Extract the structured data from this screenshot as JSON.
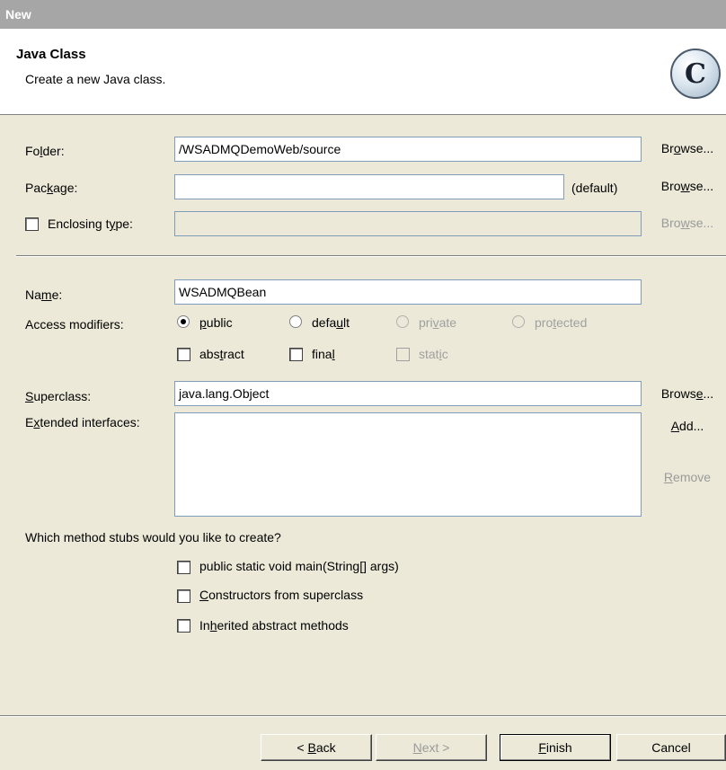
{
  "window": {
    "title": "New"
  },
  "header": {
    "title": "Java Class",
    "description": "Create a new Java class.",
    "icon_letter": "C",
    "icon": "java-class-icon"
  },
  "form": {
    "folder": {
      "label": "Folder:",
      "value": "/WSADMQDemoWeb/source",
      "browse": "Browse..."
    },
    "package": {
      "label": "Package:",
      "value": "",
      "suffix": "(default)",
      "browse": "Browse..."
    },
    "enclosing": {
      "label": "Enclosing type:",
      "value": "",
      "checked": false,
      "browse": "Browse..."
    },
    "name": {
      "label": "Name:",
      "value": "WSADMQBean"
    },
    "access": {
      "label": "Access modifiers:",
      "options": [
        "public",
        "default",
        "private",
        "protected"
      ],
      "selected": "public"
    },
    "modifiers": [
      "abstract",
      "final",
      "static"
    ],
    "superclass": {
      "label": "Superclass:",
      "value": "java.lang.Object",
      "browse": "Browse..."
    },
    "interfaces": {
      "label": "Extended interfaces:",
      "add": "Add...",
      "remove": "Remove"
    },
    "stubs": {
      "question": "Which method stubs would you like to create?",
      "options": [
        "public static void main(String[] args)",
        "Constructors from superclass",
        "Inherited abstract methods"
      ]
    }
  },
  "footer": {
    "back": "< Back",
    "next": "Next >",
    "finish": "Finish",
    "cancel": "Cancel"
  }
}
